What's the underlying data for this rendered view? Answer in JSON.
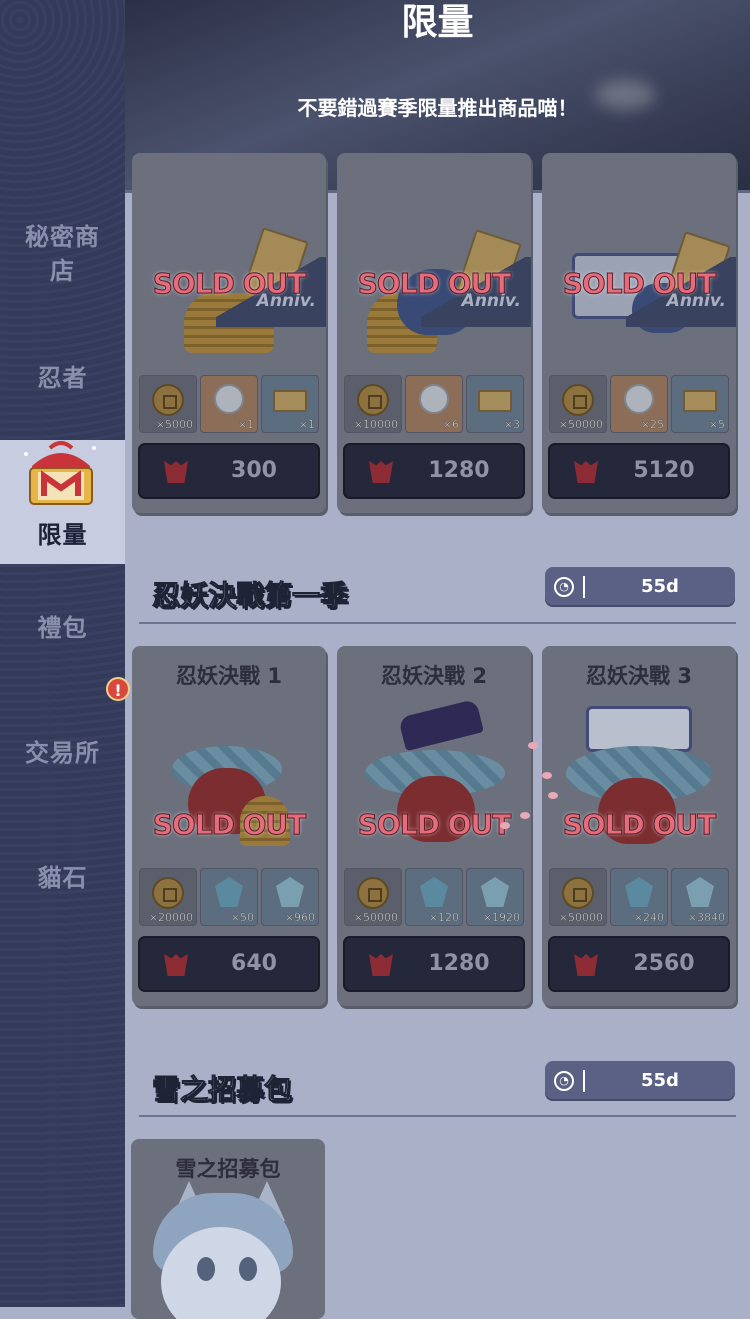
{
  "header": {
    "title": "限量",
    "subtitle": "不要錯過賽季限量推出商品喵！"
  },
  "sidebar": {
    "items": [
      {
        "label": "秘密商店",
        "line1": "秘密商",
        "line2": "店"
      },
      {
        "label": "忍者"
      },
      {
        "label": "限量",
        "active": true
      },
      {
        "label": "禮包"
      },
      {
        "label": "交易所",
        "alert": "!"
      },
      {
        "label": "貓石"
      }
    ]
  },
  "top_row": {
    "cards": [
      {
        "sold_label": "SOLD OUT",
        "anniv": "Anniv.",
        "rewards": [
          {
            "icon": "coin-icon",
            "qty": "×5000"
          },
          {
            "icon": "silver-coin-icon",
            "qty": "×1"
          },
          {
            "icon": "ticket-icon",
            "qty": "×1"
          }
        ],
        "price": "300"
      },
      {
        "sold_label": "SOLD OUT",
        "anniv": "Anniv.",
        "rewards": [
          {
            "icon": "coin-icon",
            "qty": "×10000"
          },
          {
            "icon": "silver-coin-icon",
            "qty": "×6"
          },
          {
            "icon": "ticket-icon",
            "qty": "×3"
          }
        ],
        "price": "1280"
      },
      {
        "sold_label": "SOLD OUT",
        "anniv": "Anniv.",
        "rewards": [
          {
            "icon": "coin-icon",
            "qty": "×50000"
          },
          {
            "icon": "silver-coin-icon",
            "qty": "×25"
          },
          {
            "icon": "ticket-icon",
            "qty": "×5"
          }
        ],
        "price": "5120"
      }
    ]
  },
  "section1": {
    "title": "忍妖決戰第一季",
    "timer": "55d",
    "cards": [
      {
        "name": "忍妖決戰 1",
        "sold_label": "SOLD OUT",
        "rewards": [
          {
            "icon": "coin-icon",
            "qty": "×20000"
          },
          {
            "icon": "crystal-icon",
            "qty": "×50"
          },
          {
            "icon": "crystal-shard-icon",
            "qty": "×960"
          }
        ],
        "price": "640"
      },
      {
        "name": "忍妖決戰 2",
        "sold_label": "SOLD OUT",
        "rewards": [
          {
            "icon": "coin-icon",
            "qty": "×50000"
          },
          {
            "icon": "crystal-icon",
            "qty": "×120"
          },
          {
            "icon": "crystal-shard-icon",
            "qty": "×1920"
          }
        ],
        "price": "1280"
      },
      {
        "name": "忍妖決戰 3",
        "sold_label": "SOLD OUT",
        "rewards": [
          {
            "icon": "coin-icon",
            "qty": "×50000"
          },
          {
            "icon": "crystal-icon",
            "qty": "×240"
          },
          {
            "icon": "crystal-shard-icon",
            "qty": "×3840"
          }
        ],
        "price": "2560"
      }
    ]
  },
  "section2": {
    "title": "雪之招募包",
    "timer": "55d",
    "cards": [
      {
        "name": "雪之招募包"
      }
    ]
  },
  "colors": {
    "sidebar_bg": "#363c5c",
    "content_bg": "#aab0c7",
    "sold_out": "#e46c7b",
    "timer_bg": "#5a6185",
    "alert": "#d8483d"
  }
}
